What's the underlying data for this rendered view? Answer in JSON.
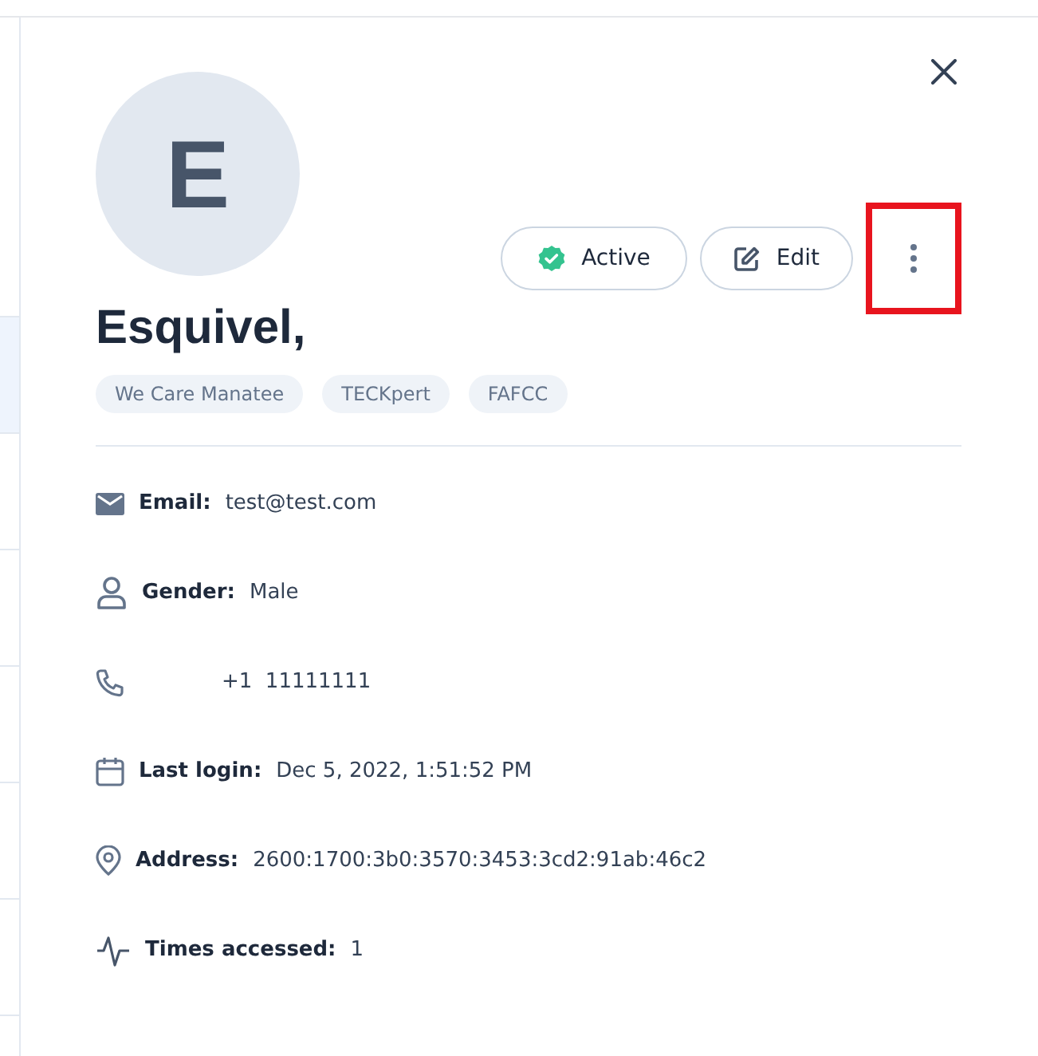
{
  "profile": {
    "initial": "E",
    "name": "Esquivel,",
    "status": {
      "label": "Active",
      "active": true
    },
    "edit_button": "Edit",
    "tags": [
      "We Care Manatee",
      "TECKpert",
      "FAFCC"
    ]
  },
  "details": [
    {
      "kind": "email",
      "label": "Email:",
      "value": "test@test.com"
    },
    {
      "kind": "person",
      "label": "Gender:",
      "value": "Male"
    },
    {
      "kind": "phone",
      "value": "+1  11111111"
    },
    {
      "kind": "calendar",
      "label": "Last login:",
      "value": "Dec 5, 2022, 1:51:52 PM"
    },
    {
      "kind": "location",
      "label": "Address:",
      "value": "2600:1700:3b0:3570:3453:3cd2:91ab:46c2"
    },
    {
      "kind": "activity",
      "label": "Times accessed:",
      "value": "1"
    }
  ]
}
